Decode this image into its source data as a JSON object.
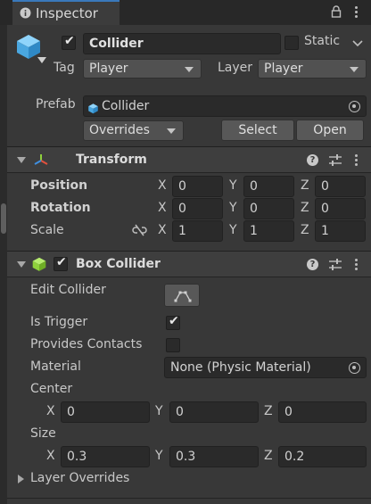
{
  "window": {
    "tab_title": "Inspector"
  },
  "object": {
    "name": "Collider",
    "active": true,
    "static_label": "Static",
    "static_checked": false,
    "tag_label": "Tag",
    "tag_value": "Player",
    "layer_label": "Layer",
    "layer_value": "Player"
  },
  "prefab": {
    "label": "Prefab",
    "asset": "Collider",
    "overrides_label": "Overrides",
    "select_label": "Select",
    "open_label": "Open"
  },
  "transform": {
    "title": "Transform",
    "position_label": "Position",
    "rotation_label": "Rotation",
    "scale_label": "Scale",
    "axis_x": "X",
    "axis_y": "Y",
    "axis_z": "Z",
    "position": {
      "x": "0",
      "y": "0",
      "z": "0"
    },
    "rotation": {
      "x": "0",
      "y": "0",
      "z": "0"
    },
    "scale": {
      "x": "1",
      "y": "1",
      "z": "1"
    }
  },
  "box_collider": {
    "title": "Box Collider",
    "enabled": true,
    "edit_collider_label": "Edit Collider",
    "is_trigger_label": "Is Trigger",
    "is_trigger": true,
    "provides_contacts_label": "Provides Contacts",
    "provides_contacts": false,
    "material_label": "Material",
    "material_value": "None (Physic Material)",
    "center_label": "Center",
    "center": {
      "x": "0",
      "y": "0",
      "z": "0"
    },
    "size_label": "Size",
    "size": {
      "x": "0.3",
      "y": "0.3",
      "z": "0.2"
    },
    "layer_overrides_label": "Layer Overrides"
  },
  "colors": {
    "background": "#383838",
    "header": "#3e3e3e",
    "field": "#2a2a2a",
    "accent": "#3a79bb",
    "cube_blue": "#5db8ef",
    "collider_green": "#8fd13c"
  },
  "icons": [
    "info-icon",
    "lock-icon",
    "kebab-icon",
    "cube-icon",
    "transform-icon",
    "help-icon",
    "preset-icon",
    "link-icon",
    "box-collider-icon",
    "edit-collider-icon",
    "target-icon"
  ]
}
